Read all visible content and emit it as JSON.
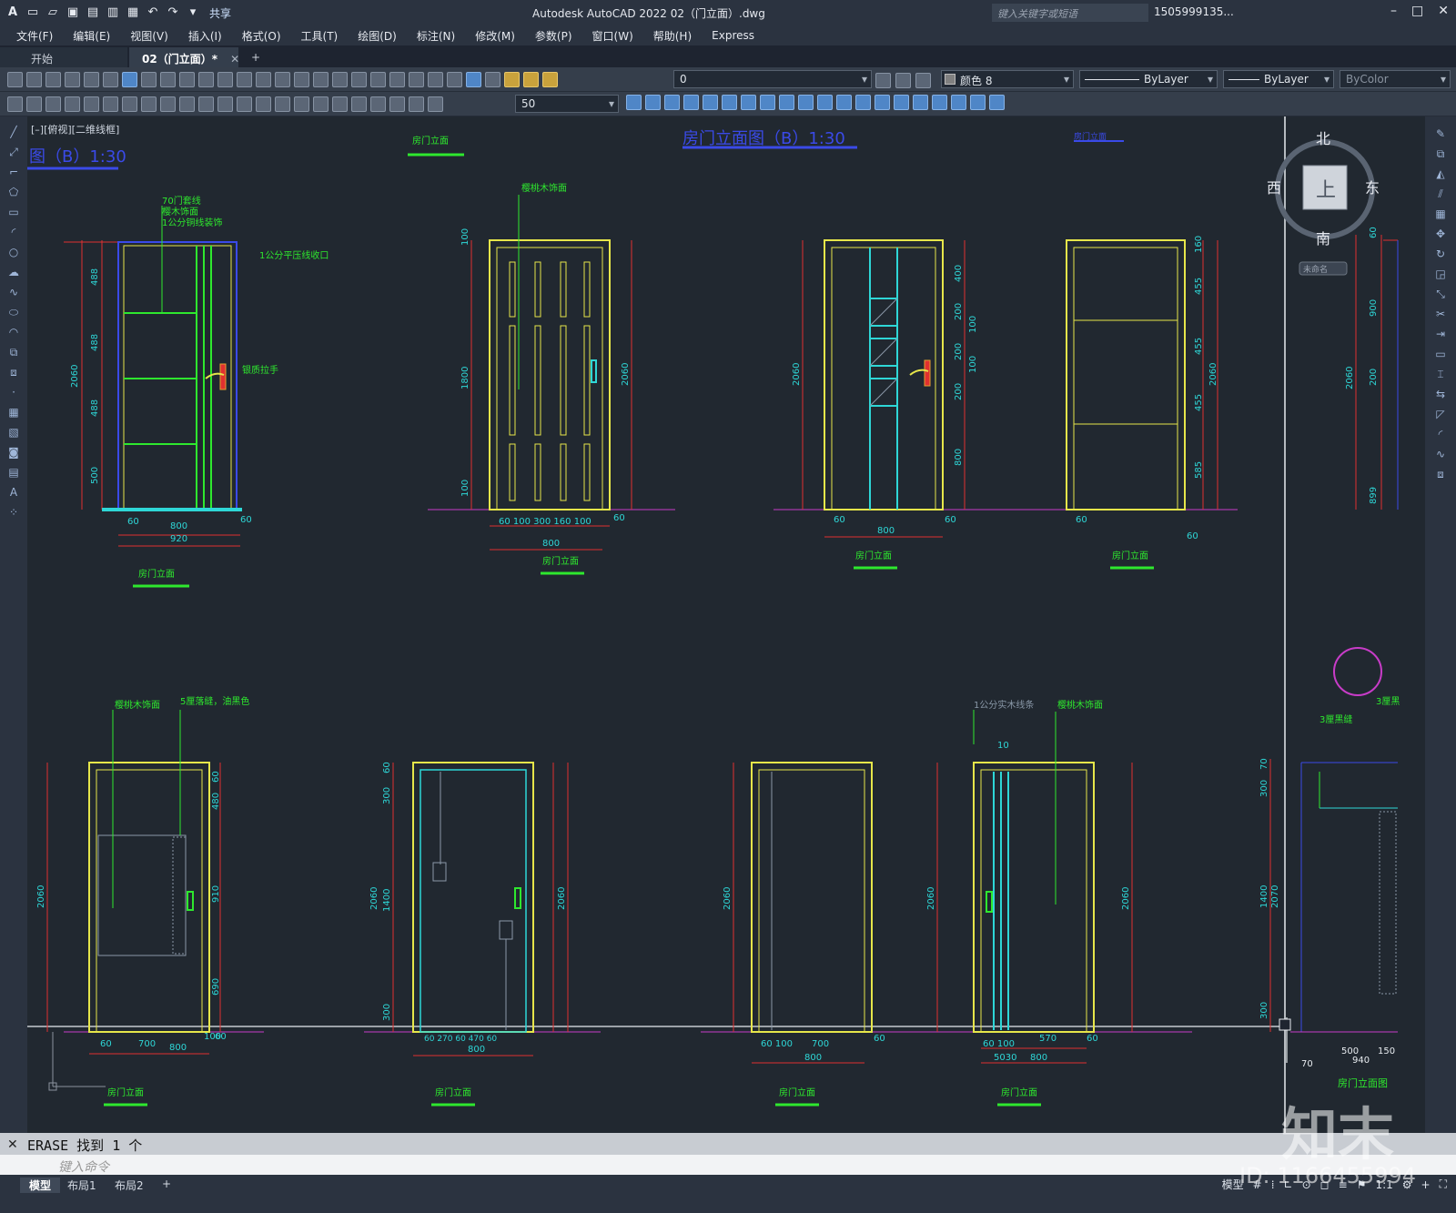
{
  "titlebar": {
    "app_title": "Autodesk AutoCAD 2022    02（门立面）.dwg",
    "share": "共享",
    "search_placeholder": "键入关键字或短语",
    "user": "1505999135...",
    "minimize": "–",
    "maximize": "□",
    "close": "✕"
  },
  "menu": [
    "文件(F)",
    "编辑(E)",
    "视图(V)",
    "插入(I)",
    "格式(O)",
    "工具(T)",
    "绘图(D)",
    "标注(N)",
    "修改(M)",
    "参数(P)",
    "窗口(W)",
    "帮助(H)",
    "Express"
  ],
  "tabs": {
    "start": "开始",
    "active": "02（门立面）*",
    "close": "✕",
    "new": "+"
  },
  "toolbar": {
    "layer": "0",
    "color": "颜色 8",
    "linetype": "ByLayer",
    "lineweight": "ByLayer",
    "plotstyle": "ByColor",
    "dimscale": "50"
  },
  "canvas": {
    "view_control": "[–][俯视][二维线框]",
    "top_title_left": "图（B）1:30",
    "top_title_mid": "房门立面图（B）1:30",
    "door_label": "房门立面",
    "viewcube": {
      "north": "北",
      "south": "南",
      "east": "东",
      "west": "西",
      "top": "上",
      "wcs": "未命名"
    },
    "annotations": {
      "d1_a": "70门套线",
      "d1_b": "樱木饰面",
      "d1_c": "1公分铜线装饰",
      "d1_d": "1公分平压线收口",
      "d1_e": "银质拉手",
      "d2_a": "樱桃木饰面",
      "d5_a": "樱桃木饰面",
      "d5_b": "5厘落缝，油黑色",
      "d8_a": "1公分实木线条",
      "d8_b": "樱桃木饰面",
      "d9_a": "3厘黑缝",
      "d9_b": "3厘黑"
    },
    "dims": {
      "d1": {
        "h": "2060",
        "seg": [
          "488",
          "488",
          "488",
          "500"
        ],
        "w1": "800",
        "w2": "920",
        "s1": "60",
        "s2": "60"
      },
      "d2": {
        "h1": "1800",
        "h2": "2060",
        "top": "100",
        "bot": "100",
        "segs": "60 100 300 160 100",
        "w": "800",
        "r": "60"
      },
      "d3": {
        "h": "2060",
        "segs": [
          "400",
          "200",
          "200",
          "200",
          "800"
        ],
        "s": [
          "100",
          "100"
        ],
        "w": "800",
        "s1": "60",
        "s2": "60"
      },
      "d4": {
        "h": "2060",
        "segs": [
          "160",
          "455",
          "455",
          "455",
          "585"
        ],
        "s1": "60",
        "s2": "60"
      },
      "d5": {
        "h": "2060",
        "segs": [
          "60",
          "480",
          "910",
          "690"
        ],
        "w1": "700",
        "w2": "800",
        "s1": "60",
        "s2": "100",
        "s3": "60"
      },
      "d6": {
        "h": "2060",
        "segs": [
          "60",
          "300",
          "1400",
          "300"
        ],
        "w": "800",
        "s": "60 270 60 470 60"
      },
      "d7": {
        "h": "2060",
        "w1": "700",
        "w2": "800",
        "s1": "60 100",
        "s2": "60"
      },
      "d8": {
        "h": "2060",
        "top": "10",
        "w1": "570",
        "w2": "800",
        "s": "60 100",
        "s2": "5030",
        "s3": "60"
      },
      "d9": {
        "h": "2070",
        "h2": "1400",
        "segs": [
          "70",
          "300",
          "300"
        ],
        "w1": "500",
        "w2": "940",
        "s": "150",
        "s2": "70",
        "title": "房门立面图"
      },
      "side": {
        "segs": [
          "60",
          "900",
          "200",
          "899"
        ],
        "h": "2060"
      }
    }
  },
  "command": {
    "history": "ERASE  找到  1  个",
    "prompt_placeholder": "键入命令"
  },
  "statusbar": {
    "layouts": [
      "模型",
      "布局1",
      "布局2",
      "+"
    ],
    "model": "模型",
    "scale": "1:1"
  },
  "watermark": {
    "brand": "知末",
    "id": "ID: 1166455994"
  },
  "colors": {
    "canvas": "#212830",
    "yellow": "#e6e64a",
    "green": "#2ee82e",
    "cyan": "#2ed7d7",
    "red": "#e03030",
    "blue": "#3a4ae8",
    "magenta": "#c83cc8"
  }
}
